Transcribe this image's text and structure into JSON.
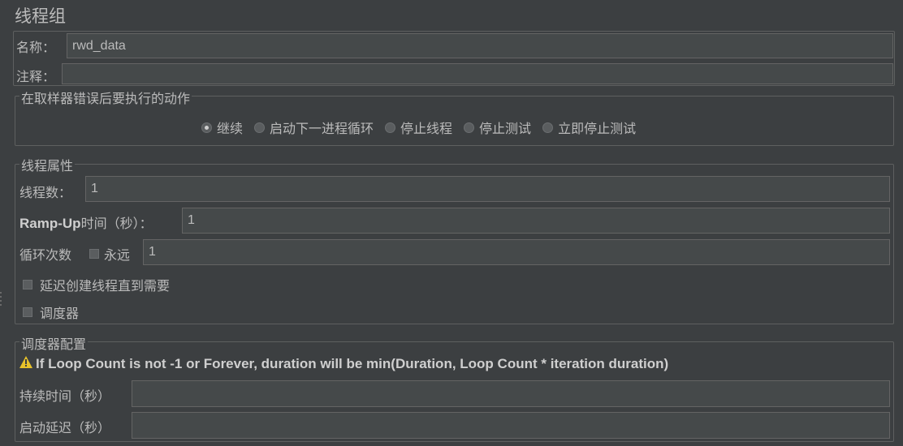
{
  "title": "线程组",
  "name_label": "名称：",
  "name_value": "rwd_data",
  "comment_label": "注释：",
  "comment_value": "",
  "error_action": {
    "legend": "在取样器错误后要执行的动作",
    "options": [
      "继续",
      "启动下一进程循环",
      "停止线程",
      "停止测试",
      "立即停止测试"
    ],
    "selected": "继续"
  },
  "thread_props": {
    "legend": "线程属性",
    "threads_label": "线程数：",
    "threads_value": "1",
    "rampup_label_bold": "Ramp-Up",
    "rampup_label_rest": "时间（秒）：",
    "rampup_value": "1",
    "loop_label": "循环次数",
    "forever_label": "永远",
    "loop_value": "1",
    "delay_label": "延迟创建线程直到需要",
    "scheduler_label": "调度器"
  },
  "scheduler_config": {
    "legend": "调度器配置",
    "warning": "If Loop Count is not -1 or Forever, duration will be min(Duration, Loop Count * iteration duration)",
    "duration_label": "持续时间（秒）",
    "duration_value": "",
    "startup_delay_label": "启动延迟（秒）",
    "startup_delay_value": ""
  }
}
